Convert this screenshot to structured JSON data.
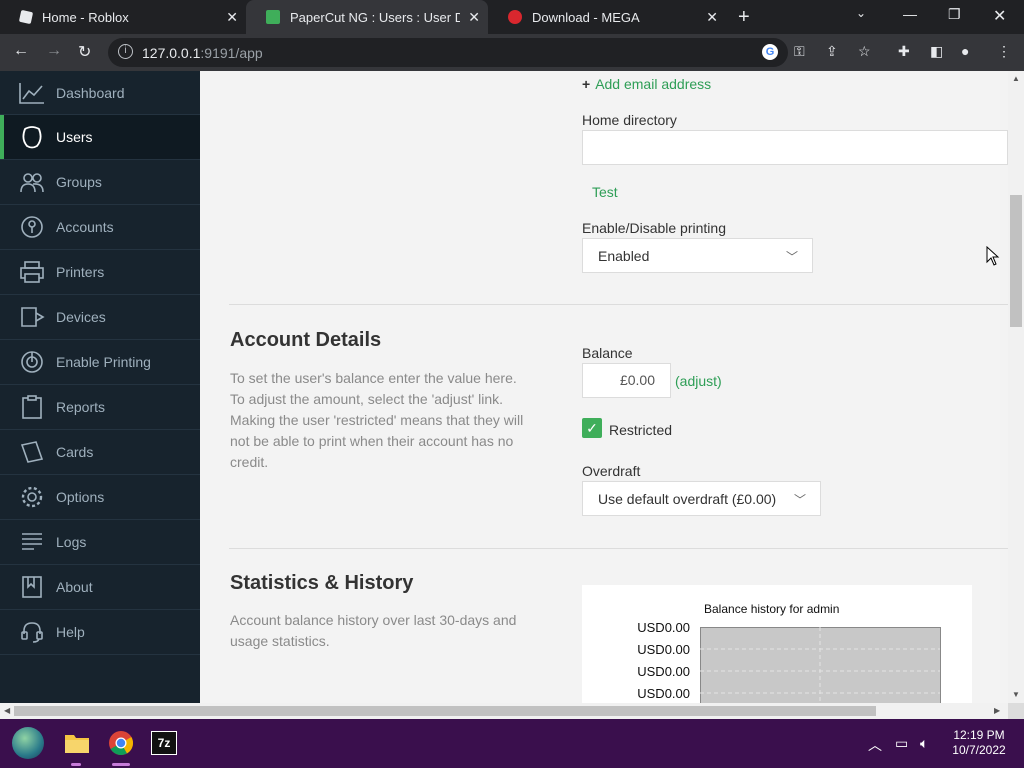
{
  "browser": {
    "tabs": [
      {
        "title": "Home - Roblox",
        "active": false
      },
      {
        "title": "PaperCut NG : Users : User Details",
        "active": true
      },
      {
        "title": "Download - MEGA",
        "active": false
      }
    ],
    "url_host": "127.0.0.1",
    "url_path": ":9191/app"
  },
  "sidebar": {
    "items": [
      {
        "label": "Dashboard",
        "icon": "dashboard-icon",
        "active": false
      },
      {
        "label": "Users",
        "icon": "user-icon",
        "active": true
      },
      {
        "label": "Groups",
        "icon": "groups-icon",
        "active": false
      },
      {
        "label": "Accounts",
        "icon": "accounts-icon",
        "active": false
      },
      {
        "label": "Printers",
        "icon": "printer-icon",
        "active": false
      },
      {
        "label": "Devices",
        "icon": "devices-icon",
        "active": false
      },
      {
        "label": "Enable Printing",
        "icon": "enable-printing-icon",
        "active": false
      },
      {
        "label": "Reports",
        "icon": "reports-icon",
        "active": false
      },
      {
        "label": "Cards",
        "icon": "cards-icon",
        "active": false
      },
      {
        "label": "Options",
        "icon": "options-icon",
        "active": false
      },
      {
        "label": "Logs",
        "icon": "logs-icon",
        "active": false
      },
      {
        "label": "About",
        "icon": "about-icon",
        "active": false
      },
      {
        "label": "Help",
        "icon": "help-icon",
        "active": false
      }
    ]
  },
  "main": {
    "add_email": "Add email address",
    "home_directory_label": "Home directory",
    "home_directory_value": "",
    "test_link": "Test",
    "printing_label": "Enable/Disable printing",
    "printing_value": "Enabled",
    "account": {
      "title": "Account Details",
      "description": "To set the user's balance enter the value here. To adjust the amount, select the 'adjust' link. Making the user 'restricted' means that they will not be able to print when their account has no credit.",
      "balance_label": "Balance",
      "balance_value": "£0.00",
      "adjust_link": "(adjust)",
      "restricted_label": "Restricted",
      "restricted_checked": true,
      "overdraft_label": "Overdraft",
      "overdraft_value": "Use default overdraft (£0.00)"
    },
    "stats": {
      "title": "Statistics & History",
      "description": "Account balance history over last 30-days and usage statistics."
    }
  },
  "chart_data": {
    "type": "line",
    "title": "Balance history for admin",
    "ytick_labels": [
      "USD0.00",
      "USD0.00",
      "USD0.00",
      "USD0.00"
    ],
    "series": []
  },
  "taskbar": {
    "time": "12:19 PM",
    "date": "10/7/2022"
  },
  "colors": {
    "accent": "#3fae5a",
    "sidebar_bg": "#17232d",
    "taskbar_bg": "#3a0f4d"
  }
}
